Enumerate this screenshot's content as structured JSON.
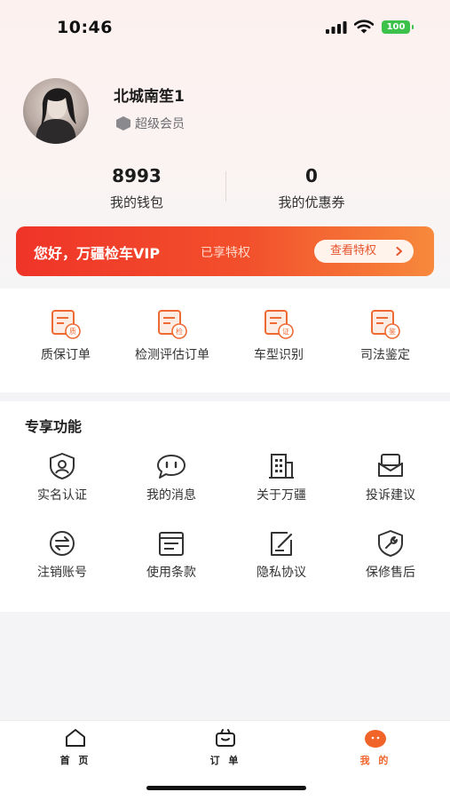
{
  "status_bar": {
    "time": "10:46",
    "battery": "100"
  },
  "profile": {
    "username": "北城南笙1",
    "member_level": "超级会员"
  },
  "stats": [
    {
      "value": "8993",
      "label": "我的钱包"
    },
    {
      "value": "0",
      "label": "我的优惠券"
    }
  ],
  "vip_banner": {
    "greeting": "您好，万疆检车VIP",
    "subtitle": "已享特权",
    "button_label": "查看特权"
  },
  "orders": [
    {
      "label": "质保订单",
      "icon": "warranty-order-icon",
      "badge": "质"
    },
    {
      "label": "检测评估订单",
      "icon": "inspection-order-icon",
      "badge": "检"
    },
    {
      "label": "车型识别",
      "icon": "car-model-icon",
      "badge": "证"
    },
    {
      "label": "司法鉴定",
      "icon": "judicial-icon",
      "badge": "鉴"
    }
  ],
  "features": {
    "title": "专享功能",
    "items": [
      {
        "label": "实名认证",
        "icon": "id-verify-icon"
      },
      {
        "label": "我的消息",
        "icon": "message-icon"
      },
      {
        "label": "关于万疆",
        "icon": "building-icon"
      },
      {
        "label": "投诉建议",
        "icon": "mail-icon"
      },
      {
        "label": "注销账号",
        "icon": "swap-icon"
      },
      {
        "label": "使用条款",
        "icon": "document-icon"
      },
      {
        "label": "隐私协议",
        "icon": "edit-icon"
      },
      {
        "label": "保修售后",
        "icon": "wrench-shield-icon"
      }
    ]
  },
  "tabs": [
    {
      "label": "首 页",
      "icon": "home-icon"
    },
    {
      "label": "订 单",
      "icon": "basket-icon"
    },
    {
      "label": "我 的",
      "icon": "profile-icon",
      "active": true
    }
  ],
  "colors": {
    "accent": "#f0642a",
    "banner_start": "#ef3428",
    "banner_end": "#f7893c",
    "order_icon": "#ef6a33"
  }
}
